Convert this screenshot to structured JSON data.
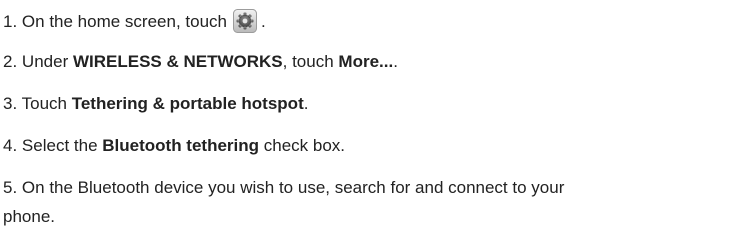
{
  "steps": [
    {
      "number": "1.",
      "text_before": "On the home screen, touch",
      "icon": "settings-icon",
      "text_after": "."
    },
    {
      "number": "2.",
      "text_before": "Under",
      "bold1": "WIRELESS & NETWORKS",
      "text_middle": ", touch",
      "bold2": "More...",
      "text_after": "."
    },
    {
      "number": "3.",
      "text_before": "Touch",
      "bold1": "Tethering & portable hotspot",
      "text_after": "."
    },
    {
      "number": "4.",
      "text_before": "Select the",
      "bold1": "Bluetooth tethering",
      "text_after": "check box."
    },
    {
      "number": "5.",
      "line1": "On the Bluetooth device you wish to use, search for and connect to your",
      "line2": "phone."
    }
  ]
}
